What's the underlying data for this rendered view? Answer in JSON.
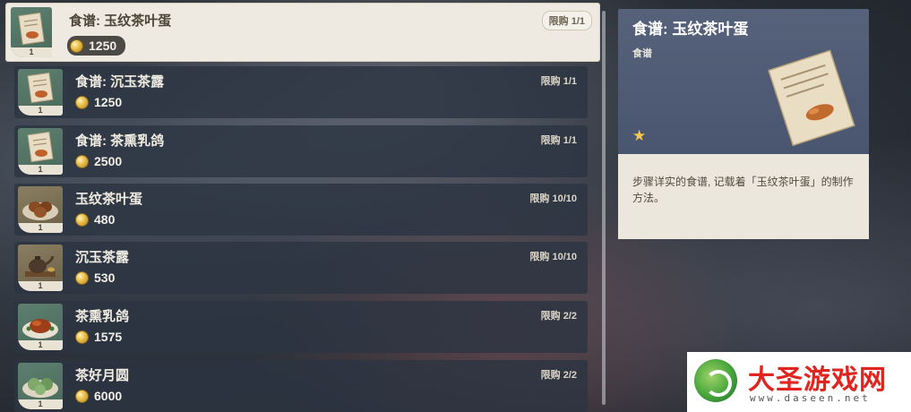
{
  "shop_items": [
    {
      "name": "食谱: 玉纹茶叶蛋",
      "price": "1250",
      "limit": "限购 1/1",
      "quantity": "1",
      "icon": "recipe-scroll-icon",
      "selected": true
    },
    {
      "name": "食谱: 沉玉茶露",
      "price": "1250",
      "limit": "限购 1/1",
      "quantity": "1",
      "icon": "recipe-scroll-icon"
    },
    {
      "name": "食谱: 茶熏乳鸽",
      "price": "2500",
      "limit": "限购 1/1",
      "quantity": "1",
      "icon": "recipe-scroll-icon"
    },
    {
      "name": "玉纹茶叶蛋",
      "price": "480",
      "limit": "限购 10/10",
      "quantity": "1",
      "icon": "tea-eggs-icon"
    },
    {
      "name": "沉玉茶露",
      "price": "530",
      "limit": "限购 10/10",
      "quantity": "1",
      "icon": "teapot-icon"
    },
    {
      "name": "茶熏乳鸽",
      "price": "1575",
      "limit": "限购 2/2",
      "quantity": "1",
      "icon": "roast-pigeon-icon"
    },
    {
      "name": "茶好月圆",
      "price": "6000",
      "limit": "限购 2/2",
      "quantity": "1",
      "icon": "mooncake-icon"
    }
  ],
  "detail": {
    "title": "食谱: 玉纹茶叶蛋",
    "type": "食谱",
    "rarity_stars": "★",
    "description": "步骤详实的食谱, 记载着「玉纹茶叶蛋」的制作方法。"
  },
  "watermark": {
    "title": "大圣游戏网",
    "url": "www.daseen.net"
  },
  "colors": {
    "row_bg": "#2c3442",
    "selected_bg": "#eeeae2",
    "detail_head": "#56617a",
    "detail_body": "#ece7dc",
    "coin": "#e8bd46",
    "star": "#f4c84e"
  }
}
